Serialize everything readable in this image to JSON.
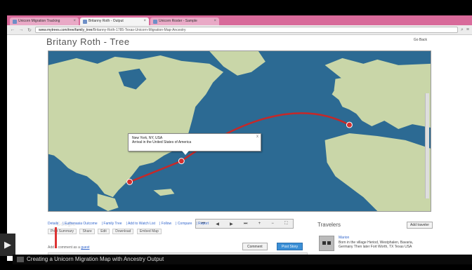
{
  "browser": {
    "tabs": [
      {
        "label": "Unicorn Migration Tracking"
      },
      {
        "label": "Britanny Roth - Output",
        "active": true
      },
      {
        "label": "Unicorn Roster - Sample"
      }
    ],
    "address": "www.mytrees.com/tree/family_tree",
    "address_rest": "/Britanny-Roth-1785-Texas-Unicorn-Migration-Map-Ancestry"
  },
  "page": {
    "title": "Britany Roth - Tree",
    "title_action": "Go Back"
  },
  "map": {
    "popup_line1": "New York, NY, USA",
    "popup_line2": "Arrival in the United States of America",
    "popup_close": "x",
    "google_label": "Google",
    "controls": [
      "⏮",
      "◀",
      "▶",
      "⏭",
      "+",
      "−",
      "⛶"
    ],
    "route_color": "#c62828",
    "water_color": "#2c6a93",
    "land_color": "#c9d6a8"
  },
  "links": [
    "Details",
    "Euthenasia Outcome",
    "Family Tree",
    "Add to Watch List",
    "Follow",
    "Compare",
    "Report"
  ],
  "sublinks": [
    "Print Summary",
    "Share",
    "Edit",
    "Download",
    "Embed Map"
  ],
  "login_prefix": "Add a comment as a",
  "login_link": "guest",
  "comment_button": "Comment",
  "submit_button": "Post Story",
  "travelers": {
    "title": "Travelers",
    "button": "Add traveler",
    "name": "Marion",
    "detail": "Born in the village Heriod, Westphalen, Bavaria, Germany Then later Fort Worth, TX Texas USA"
  },
  "caption": "Creating a Unicorn Migration Map with Ancestry Output"
}
